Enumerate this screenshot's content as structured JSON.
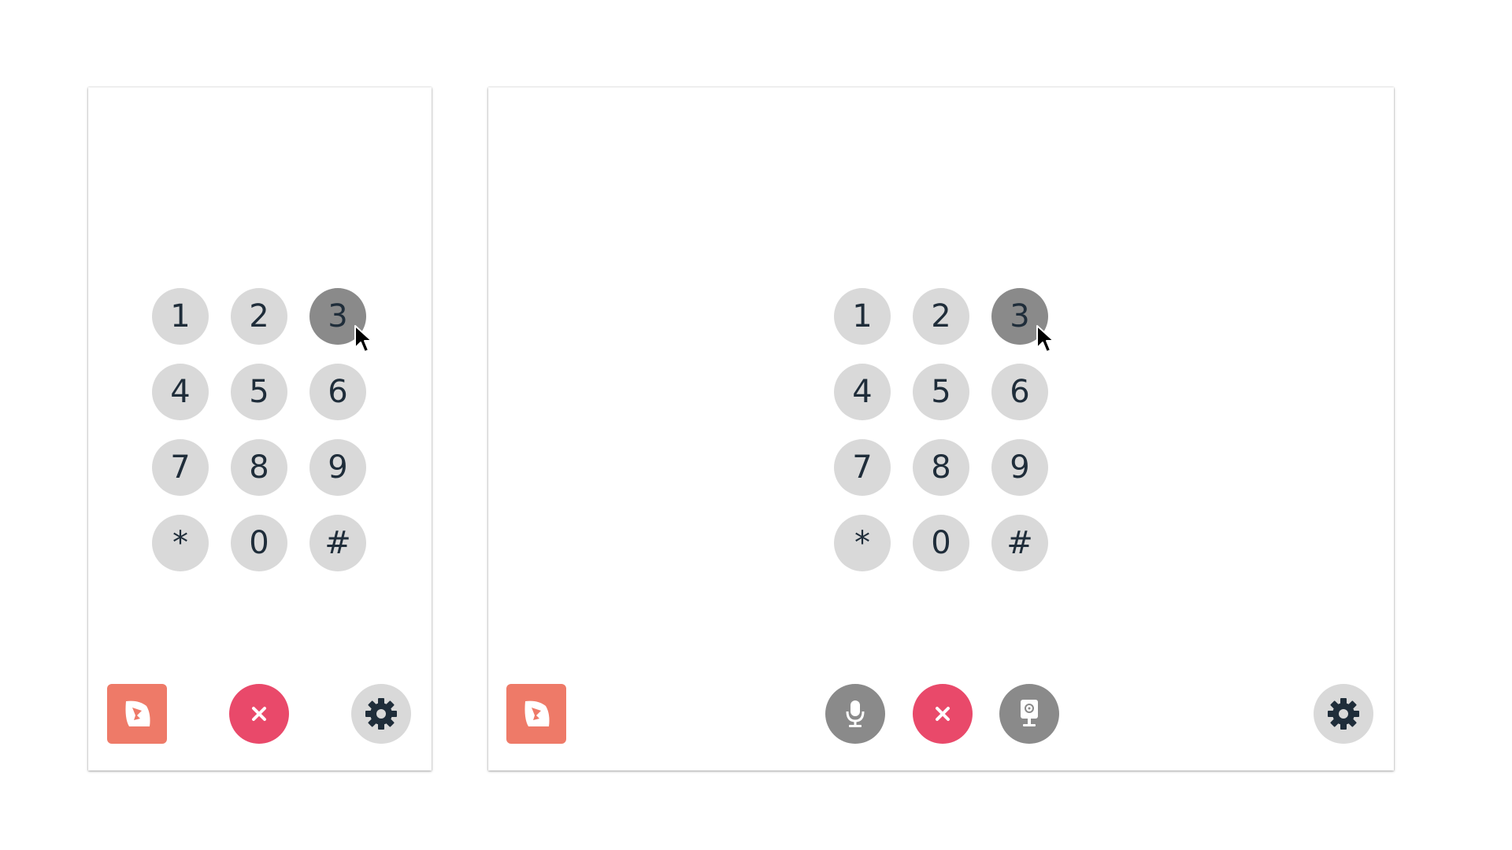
{
  "keypad": {
    "keys": [
      "1",
      "2",
      "3",
      "4",
      "5",
      "6",
      "7",
      "8",
      "9",
      "*",
      "0",
      "#"
    ],
    "pressed_key": "3"
  },
  "icons": {
    "logo": "app-logo-icon",
    "hangup": "close-icon",
    "settings": "gear-icon",
    "microphone": "microphone-icon",
    "camera": "camera-icon",
    "cursor": "mouse-pointer-icon"
  },
  "colors": {
    "key_background": "#d9d9d9",
    "key_pressed": "#8a8a8a",
    "key_text": "#1f2d3a",
    "hangup": "#e9496a",
    "logo": "#ee7a68",
    "media_buttons": "#8a8a8a"
  }
}
